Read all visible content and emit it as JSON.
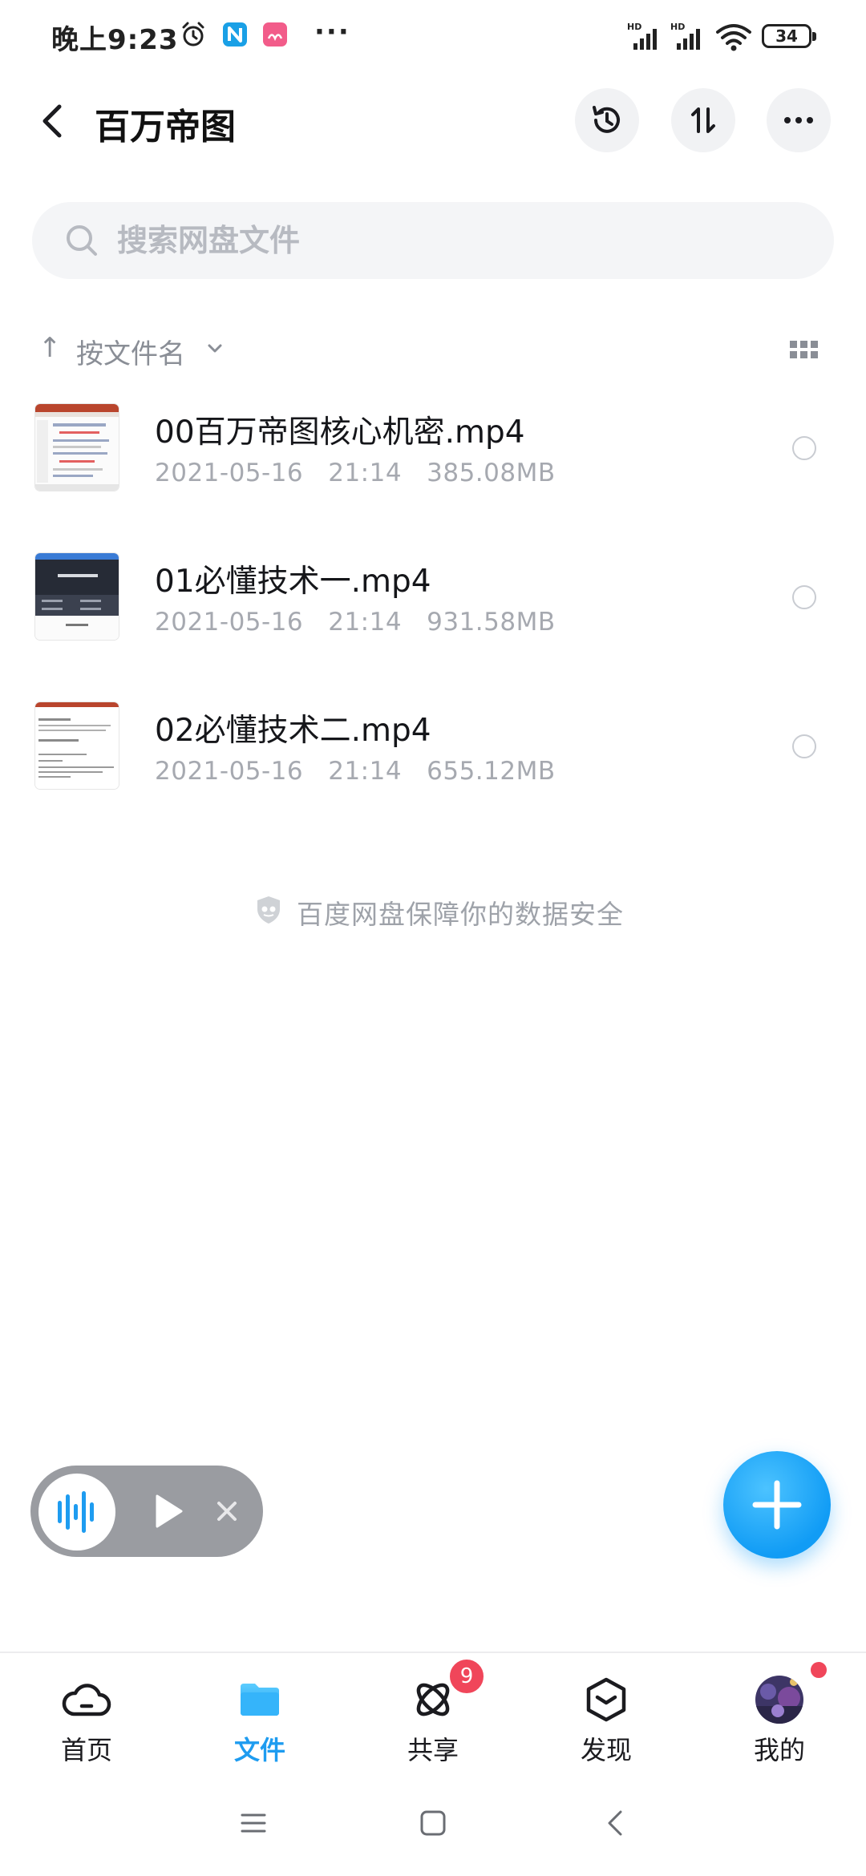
{
  "status_bar": {
    "time": "晚上9:23",
    "more": "···",
    "battery": "34",
    "icons": [
      "alarm-icon",
      "n-app-icon",
      "pink-app-icon",
      "hd-signal-icon",
      "hd-signal-icon",
      "wifi-icon",
      "battery-icon"
    ]
  },
  "header": {
    "title": "百万帝图",
    "icons": [
      "back-icon",
      "history-icon",
      "sort-icon",
      "more-icon"
    ]
  },
  "search": {
    "placeholder": "搜索网盘文件"
  },
  "sort": {
    "arrow": "↑",
    "label": "按文件名"
  },
  "files": [
    {
      "name": "00百万帝图核心机密.mp4",
      "date": "2021-05-16",
      "time": "21:14",
      "size": "385.08MB"
    },
    {
      "name": "01必懂技术一.mp4",
      "date": "2021-05-16",
      "time": "21:14",
      "size": "931.58MB"
    },
    {
      "name": "02必懂技术二.mp4",
      "date": "2021-05-16",
      "time": "21:14",
      "size": "655.12MB"
    }
  ],
  "notice": "百度网盘保障你的数据安全",
  "nav": {
    "items": [
      {
        "label": "首页",
        "icon": "cloud-home-icon"
      },
      {
        "label": "文件",
        "icon": "folder-icon"
      },
      {
        "label": "共享",
        "icon": "share-atom-icon"
      },
      {
        "label": "发现",
        "icon": "discover-box-icon"
      },
      {
        "label": "我的",
        "icon": "avatar-icon"
      }
    ],
    "active": "文件",
    "share_badge": "9"
  },
  "colors": {
    "accent": "#1e9cf0",
    "badge": "#f0465a"
  }
}
